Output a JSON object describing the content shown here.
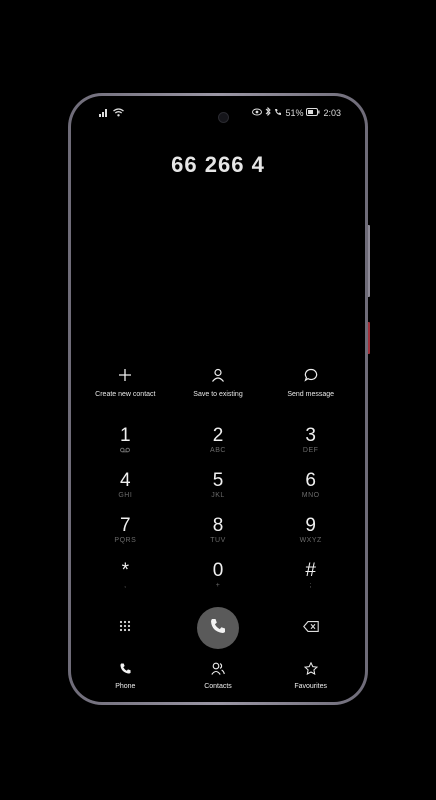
{
  "status_bar": {
    "battery": "51%",
    "time": "2:03"
  },
  "dialer": {
    "number": "66 266 4"
  },
  "actions": [
    {
      "label": "Create new contact",
      "icon": "plus-icon"
    },
    {
      "label": "Save to existing",
      "icon": "person-icon"
    },
    {
      "label": "Send message",
      "icon": "chat-bubble-icon"
    }
  ],
  "keypad": [
    {
      "num": "1",
      "sub": "∞"
    },
    {
      "num": "2",
      "sub": "ABC"
    },
    {
      "num": "3",
      "sub": "DEF"
    },
    {
      "num": "4",
      "sub": "GHI"
    },
    {
      "num": "5",
      "sub": "JKL"
    },
    {
      "num": "6",
      "sub": "MNO"
    },
    {
      "num": "7",
      "sub": "PQRS"
    },
    {
      "num": "8",
      "sub": "TUV"
    },
    {
      "num": "9",
      "sub": "WXYZ"
    },
    {
      "num": "*",
      "sub": ","
    },
    {
      "num": "0",
      "sub": "+"
    },
    {
      "num": "#",
      "sub": ";"
    }
  ],
  "nav": {
    "phone": "Phone",
    "contacts": "Contacts",
    "favourites": "Favourites"
  },
  "colors": {
    "background": "#000000",
    "frame": "#9b97a5",
    "call_button": "#5a5a5a"
  }
}
